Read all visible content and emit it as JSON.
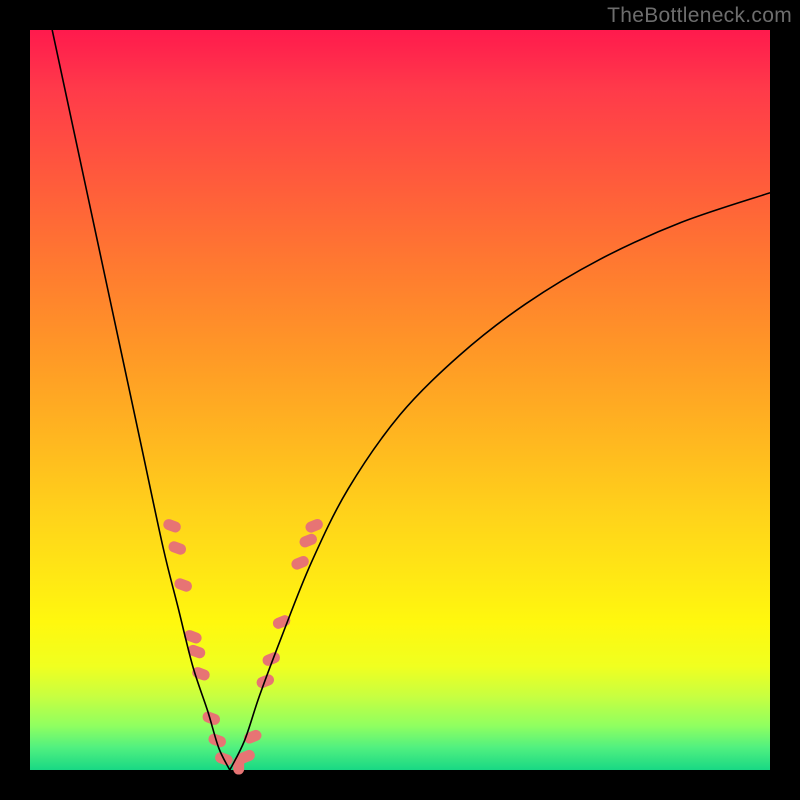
{
  "watermark": "TheBottleneck.com",
  "colors": {
    "frame": "#000000",
    "gradient_stops": [
      "#ff1a4d",
      "#ff5a3c",
      "#ff9926",
      "#ffd41a",
      "#fff80e",
      "#c8ff40",
      "#50f080",
      "#18d884"
    ],
    "curve": "#000000",
    "markers": "#e77474"
  },
  "chart_data": {
    "type": "line",
    "title": "",
    "xlabel": "",
    "ylabel": "",
    "xlim": [
      0,
      100
    ],
    "ylim": [
      0,
      100
    ],
    "note": "Axes unlabeled; values are estimated from pixel positions. y=0 is bottom, y=100 is top. Two black curves forming a V with minimum near x≈27, y≈0.",
    "series": [
      {
        "name": "left-curve",
        "x": [
          3,
          6,
          9,
          12,
          15,
          18,
          20,
          22,
          24,
          25.5,
          27
        ],
        "y": [
          100,
          86,
          72,
          58,
          44,
          30,
          22,
          14,
          8,
          3,
          0
        ]
      },
      {
        "name": "right-curve",
        "x": [
          27,
          29,
          31,
          34,
          38,
          43,
          50,
          58,
          67,
          77,
          88,
          100
        ],
        "y": [
          0,
          4,
          10,
          18,
          28,
          38,
          48,
          56,
          63,
          69,
          74,
          78
        ]
      }
    ],
    "markers": {
      "name": "highlighted-region",
      "description": "Salmon dashed blobs overlaid on both curves near the valley (roughly y between 0 and 35).",
      "points": [
        {
          "x": 19.2,
          "y": 33
        },
        {
          "x": 19.9,
          "y": 30
        },
        {
          "x": 20.7,
          "y": 25
        },
        {
          "x": 21.3,
          "y": 22
        },
        {
          "x": 22.0,
          "y": 18
        },
        {
          "x": 22.5,
          "y": 16
        },
        {
          "x": 23.1,
          "y": 13
        },
        {
          "x": 23.8,
          "y": 10
        },
        {
          "x": 24.5,
          "y": 7
        },
        {
          "x": 25.3,
          "y": 4
        },
        {
          "x": 26.2,
          "y": 1.5
        },
        {
          "x": 27.2,
          "y": 0.6
        },
        {
          "x": 28.2,
          "y": 0.6
        },
        {
          "x": 29.2,
          "y": 1.8
        },
        {
          "x": 30.1,
          "y": 4.5
        },
        {
          "x": 30.9,
          "y": 8
        },
        {
          "x": 31.8,
          "y": 12
        },
        {
          "x": 32.6,
          "y": 15
        },
        {
          "x": 34.0,
          "y": 20
        },
        {
          "x": 34.6,
          "y": 22
        },
        {
          "x": 36.5,
          "y": 28
        },
        {
          "x": 37.6,
          "y": 31
        },
        {
          "x": 38.4,
          "y": 33
        }
      ]
    }
  }
}
